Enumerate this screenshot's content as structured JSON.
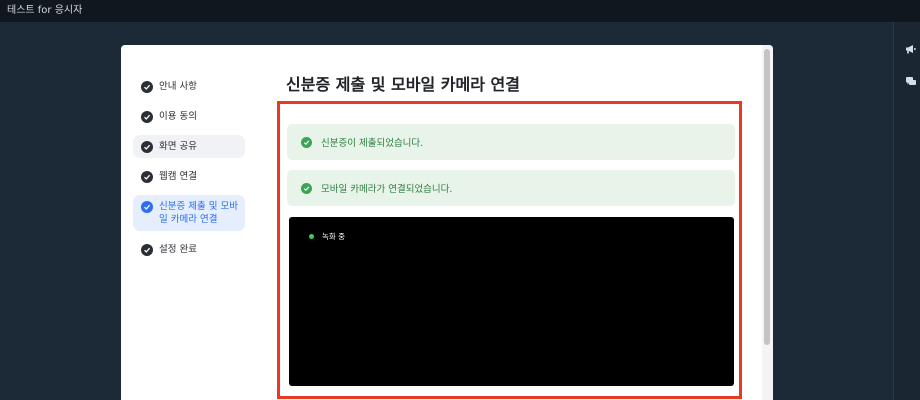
{
  "window": {
    "title": "테스트 for 응시자"
  },
  "right_rail": {
    "icons": [
      "megaphone-icon",
      "chat-icon"
    ]
  },
  "modal": {
    "title": "신분증 제출 및 모바일 카메라 연결",
    "steps": [
      {
        "label": "안내 사항",
        "state": "done"
      },
      {
        "label": "이용 동의",
        "state": "done"
      },
      {
        "label": "화면 공유",
        "state": "done"
      },
      {
        "label": "웹캠 연결",
        "state": "done"
      },
      {
        "label": "신분증 제출 및 모바일 카메라 연결",
        "state": "current"
      },
      {
        "label": "설정 완료",
        "state": "done"
      }
    ],
    "status_messages": [
      "신분증이 제출되었습니다.",
      "모바일 카메라가 연결되었습니다."
    ],
    "video": {
      "recording_label": "녹화 중"
    }
  },
  "colors": {
    "accent": "#2d6df0",
    "success": "#3aa655",
    "highlight_border": "#e63a22",
    "recording_dot": "#3ccf5b"
  }
}
